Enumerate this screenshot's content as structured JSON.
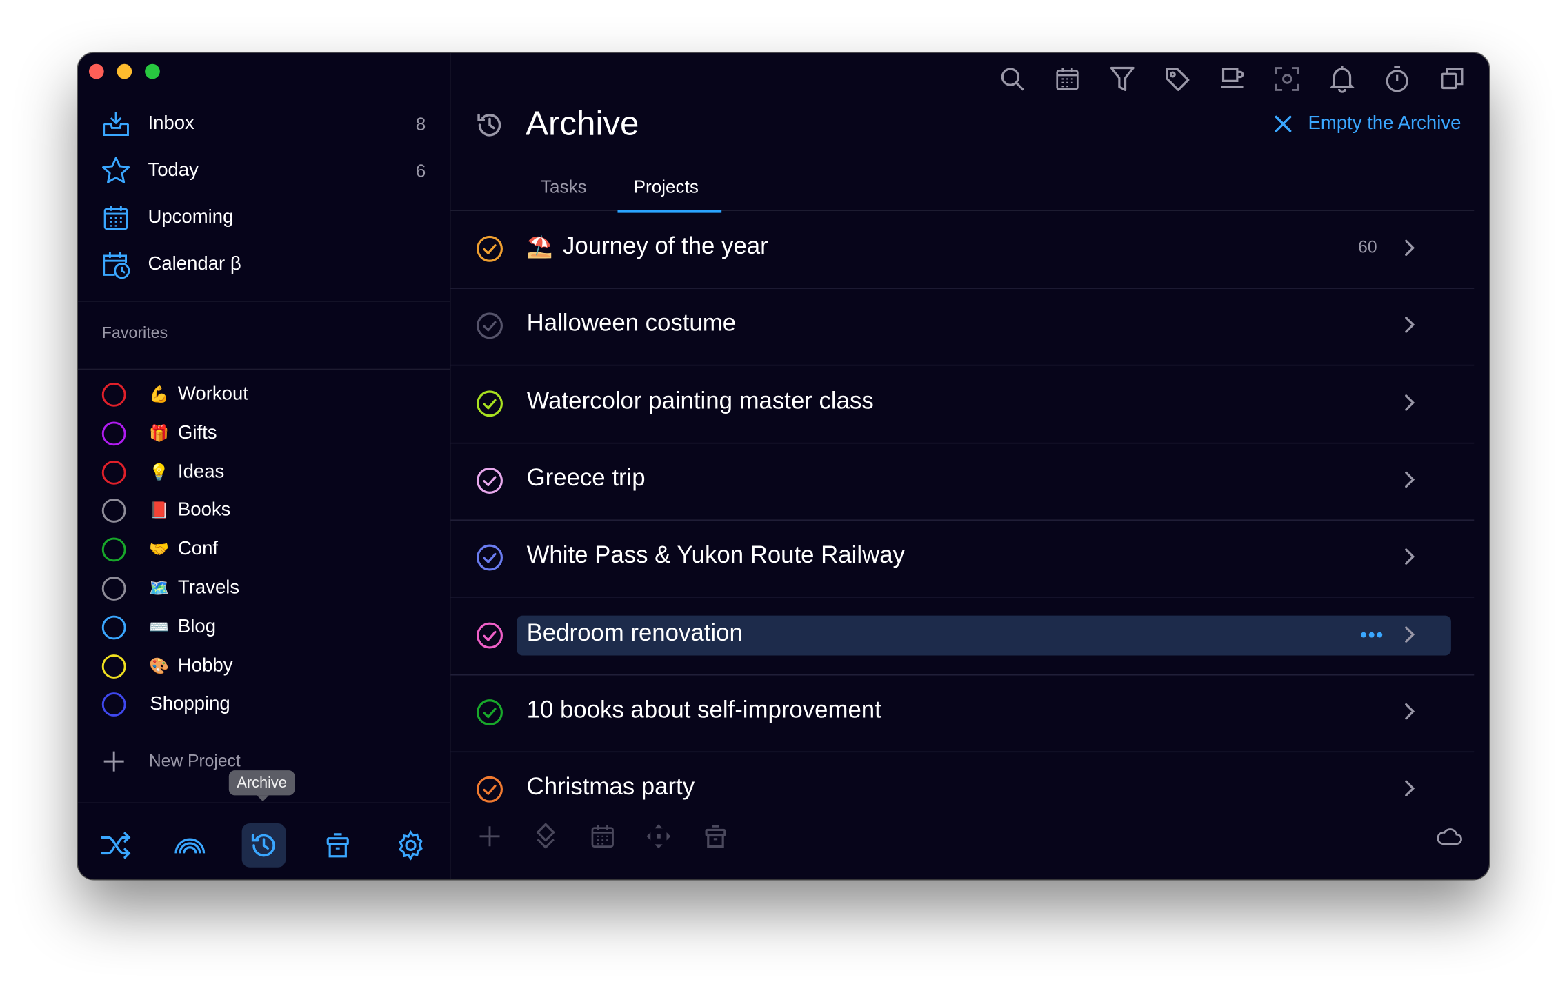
{
  "sidebar": {
    "nav": [
      {
        "label": "Inbox",
        "count": "8",
        "icon": "inbox-icon"
      },
      {
        "label": "Today",
        "count": "6",
        "icon": "star-icon"
      },
      {
        "label": "Upcoming",
        "count": "",
        "icon": "calendar-icon"
      },
      {
        "label": "Calendar β",
        "count": "",
        "icon": "calendar-clock-icon"
      }
    ],
    "favorites_title": "Favorites",
    "projects": [
      {
        "label": "Workout",
        "emoji": "💪",
        "color": "#e0202a"
      },
      {
        "label": "Gifts",
        "emoji": "🎁",
        "color": "#b01cf0"
      },
      {
        "label": "Ideas",
        "emoji": "💡",
        "color": "#e0202a"
      },
      {
        "label": "Books",
        "emoji": "📕",
        "color": "#8e8c98"
      },
      {
        "label": "Conf",
        "emoji": "🤝",
        "color": "#18a82a"
      },
      {
        "label": "Travels",
        "emoji": "🗺️",
        "color": "#8e8c98"
      },
      {
        "label": "Blog",
        "emoji": "⌨️",
        "color": "#3aa7ff"
      },
      {
        "label": "Hobby",
        "emoji": "🎨",
        "color": "#f0e020"
      },
      {
        "label": "Shopping",
        "emoji": "",
        "color": "#3f48ee"
      }
    ],
    "new_project": "New Project",
    "tooltip": "Archive",
    "bottom_icons": [
      "shuffle-icon",
      "rainbow-icon",
      "archive-history-icon",
      "trash-icon",
      "settings-icon"
    ]
  },
  "main": {
    "title": "Archive",
    "empty_button": "Empty the Archive",
    "tabs": [
      {
        "label": "Tasks",
        "active": false
      },
      {
        "label": "Projects",
        "active": true
      }
    ],
    "toolbar_icons": [
      "search-icon",
      "calendar-icon",
      "filter-icon",
      "tag-icon",
      "coffee-icon",
      "focus-icon",
      "bell-icon",
      "timer-icon",
      "copy-icon"
    ],
    "rows": [
      {
        "label": "Journey of the year",
        "emoji": "⛱️",
        "count": "60",
        "color": "#f0a030",
        "selected": false
      },
      {
        "label": "Halloween costume",
        "emoji": "",
        "count": "",
        "color": "#55536a",
        "selected": false
      },
      {
        "label": "Watercolor painting master class",
        "emoji": "",
        "count": "",
        "color": "#a8e020",
        "selected": false
      },
      {
        "label": "Greece trip",
        "emoji": "",
        "count": "",
        "color": "#e8a8ec",
        "selected": false
      },
      {
        "label": "White Pass & Yukon Route Railway",
        "emoji": "",
        "count": "",
        "color": "#6a7cf0",
        "selected": false
      },
      {
        "label": "Bedroom renovation",
        "emoji": "",
        "count": "",
        "color": "#f060c8",
        "selected": true
      },
      {
        "label": "10 books about self-improvement",
        "emoji": "",
        "count": "",
        "color": "#18a82a",
        "selected": false
      },
      {
        "label": "Christmas party",
        "emoji": "",
        "count": "",
        "color": "#f07a30",
        "selected": false
      }
    ],
    "footer_icons": [
      "add-icon",
      "move-icon",
      "calendar-icon",
      "arrows-icon",
      "trash-icon",
      "cloud-icon"
    ]
  },
  "colors": {
    "accent": "#2aa4ff",
    "background": "#07051a",
    "selected_row": "#1d2b4b"
  }
}
